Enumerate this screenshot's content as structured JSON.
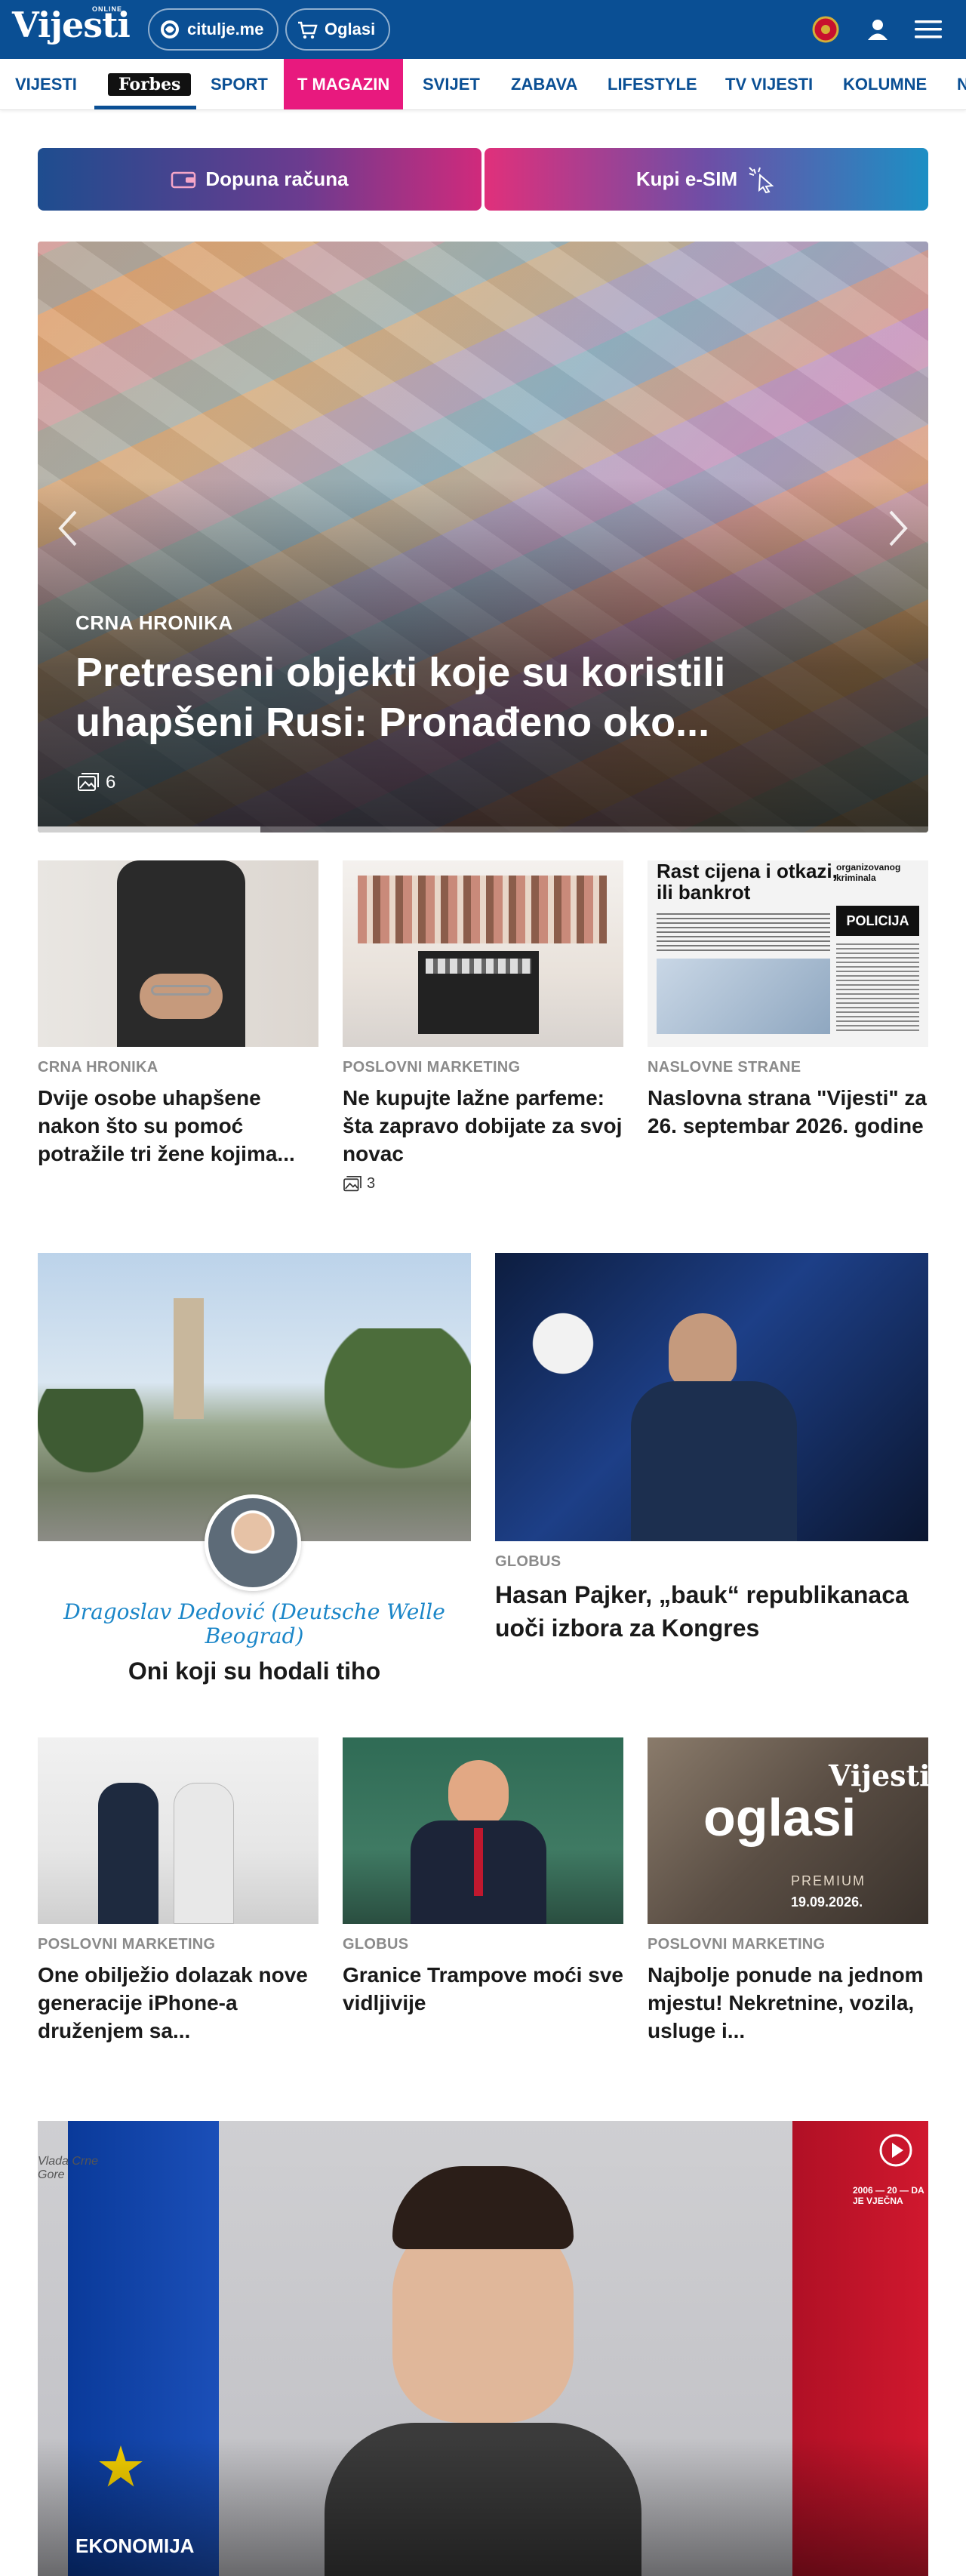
{
  "header": {
    "logo": "Vijesti",
    "logo_tag": "ONLINE",
    "pill_umrlice": "citulje.me",
    "pill_oglasi": "Oglasi"
  },
  "nav": {
    "items": [
      {
        "label": "VIJESTI"
      },
      {
        "label": "Forbes"
      },
      {
        "label": "SPORT"
      },
      {
        "label": "T MAGAZIN"
      },
      {
        "label": "SVIJET"
      },
      {
        "label": "ZABAVA"
      },
      {
        "label": "LIFESTYLE"
      },
      {
        "label": "TV VIJESTI"
      },
      {
        "label": "KOLUMNE"
      },
      {
        "label": "N"
      }
    ]
  },
  "banners": {
    "left_label": "Dopuna računa",
    "right_label": "Kupi e-SIM"
  },
  "hero": {
    "category": "CRNA HRONIKA",
    "title": "Pretreseni objekti koje su koristili uhapšeni Rusi: Pronađeno oko...",
    "gallery_count": "6",
    "slide_progress": 0.25
  },
  "row1": [
    {
      "category": "CRNA HRONIKA",
      "title": "Dvije osobe uhapšene nakon što su pomoć potražile tri žene kojima..."
    },
    {
      "category": "POSLOVNI MARKETING",
      "title": "Ne kupujte lažne parfeme: šta zapravo dobijate za svoj novac",
      "gallery_count": "3"
    },
    {
      "category": "NASLOVNE STRANE",
      "title": "Naslovna strana \"Vijesti\" za 26. septembar 2026. godine",
      "thumb_headline": "Rast cijena i otkazi, ili bankrot",
      "thumb_label": "organizovanog kriminala",
      "thumb_police": "POLICIJA"
    }
  ],
  "row2": {
    "left": {
      "author": "Dragoslav Dedović (Deutsche Welle Beograd)",
      "title": "Oni koji su hodali tiho"
    },
    "right": {
      "category": "GLOBUS",
      "title": "Hasan Pajker, „bauk“ republikanaca uoči izbora za Kongres"
    }
  },
  "row3": [
    {
      "category": "POSLOVNI MARKETING",
      "title": "One obilježio dolazak nove generacije iPhone-a druženjem sa..."
    },
    {
      "category": "GLOBUS",
      "title": "Granice Trampove moći sve vidljivije"
    },
    {
      "category": "POSLOVNI MARKETING",
      "title": "Najbolje ponude na jednom mjestu! Nekretnine, vozila, usluge i...",
      "thumb_brand": "Vijesti",
      "thumb_word": "oglasi",
      "thumb_premium": "PREMIUM",
      "thumb_date": "19.09.2026."
    }
  ],
  "video": {
    "category": "EKONOMIJA",
    "left_logo": "Vlada Crne Gore",
    "right_logo": "2006 — 20 — DA JE VJEČNA"
  }
}
